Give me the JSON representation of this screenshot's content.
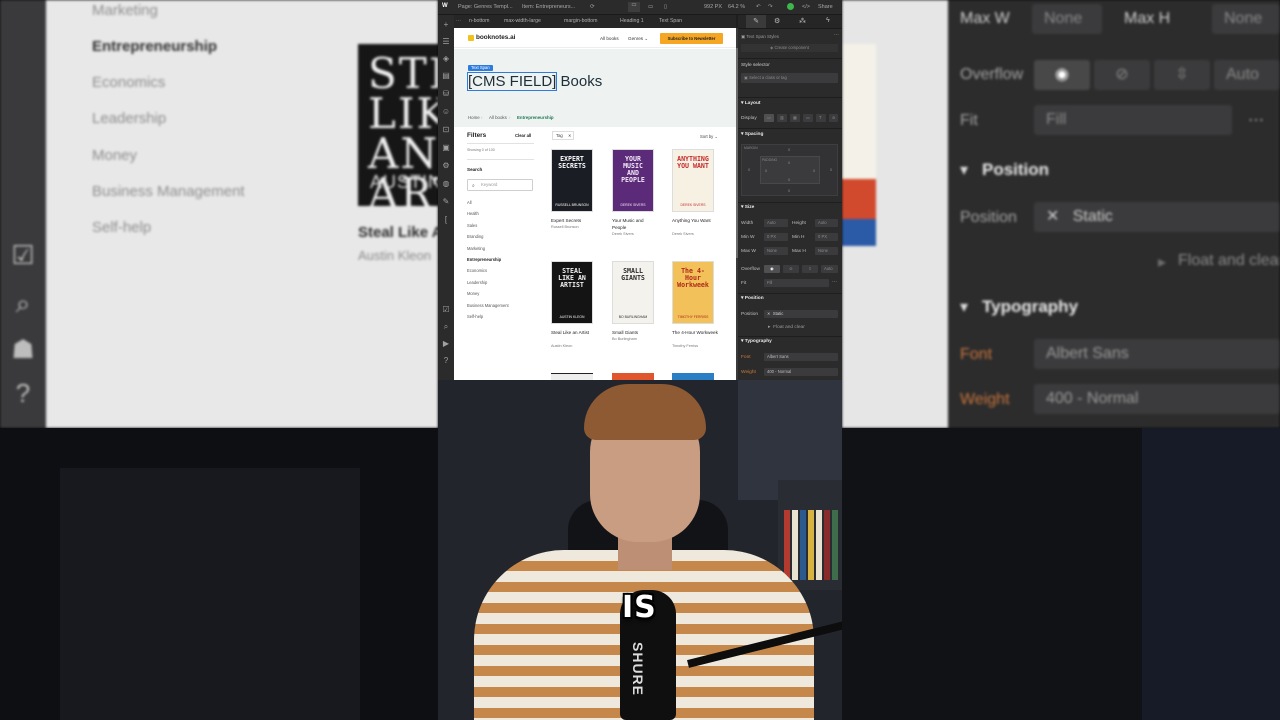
{
  "background_left": {
    "categories": [
      {
        "label": "Marketing",
        "active": false
      },
      {
        "label": "Entrepreneurship",
        "active": true
      },
      {
        "label": "Economics",
        "active": false
      },
      {
        "label": "Leadership",
        "active": false
      },
      {
        "label": "Money",
        "active": false
      },
      {
        "label": "Business Management",
        "active": false
      },
      {
        "label": "Self-help",
        "active": false
      }
    ],
    "book_cover_text": "STEAL LIKE AN ARTIST",
    "book_cover_author": "AUSTIN",
    "book_title": "Steal Like A",
    "book_author": "Austin Kleon"
  },
  "background_right": {
    "max_w_label": "Max W",
    "max_w_value": "None",
    "max_h_label": "Max H",
    "max_h_value": "None",
    "overflow_label": "Overflow",
    "overflow_auto": "Auto",
    "fit_label": "Fit",
    "fit_value": "Fill",
    "position_header": "Position",
    "position_label": "Position",
    "position_value": "Static",
    "float_clear": "Float and clear",
    "typography_header": "Typography",
    "font_label": "Font",
    "font_value": "Albert Sans",
    "weight_label": "Weight",
    "weight_value": "400 - Normal"
  },
  "webflow": {
    "topbar": {
      "page": "Page: Genres Templ...",
      "item": "Item: Entrepreneurs...",
      "width": "992 PX",
      "zoom": "64.2 %",
      "share": "Share"
    },
    "breadcrumbs": [
      "n-bottom",
      "max-width-large",
      "margin-bottom",
      "Heading 1",
      "Text Span"
    ],
    "site": {
      "logo": "booknotes.ai",
      "nav_all_books": "All books",
      "nav_genres": "Genres",
      "nav_cta": "Subscribe to Newsletter",
      "badge": "Text Span",
      "hero_cms": "[CMS FIELD]",
      "hero_rest": " Books",
      "crumb_home": "Home",
      "crumb_all": "All books",
      "crumb_current": "Entrepreneurship",
      "filters": "Filters",
      "clear_all": "Clear all",
      "showing": "Showing 0 of 100",
      "tag": "Tag",
      "sort_by": "Sort by",
      "search_label": "Search",
      "keyword_placeholder": "Keyword",
      "filter_categories": [
        {
          "label": "All",
          "active": false
        },
        {
          "label": "Health",
          "active": false
        },
        {
          "label": "Sales",
          "active": false
        },
        {
          "label": "Branding",
          "active": false
        },
        {
          "label": "Marketing",
          "active": false
        },
        {
          "label": "Entrepreneurship",
          "active": true
        },
        {
          "label": "Economics",
          "active": false
        },
        {
          "label": "Leadership",
          "active": false
        },
        {
          "label": "Money",
          "active": false
        },
        {
          "label": "Business Management",
          "active": false
        },
        {
          "label": "Self-help",
          "active": false
        }
      ],
      "books": [
        {
          "title": "Expert Secrets",
          "author": "Russell Brunson",
          "cover": "EXPERT SECRETS",
          "cover_author": "RUSSELL BRUNSON",
          "bg": "#1b1d24",
          "fg": "#ffffff"
        },
        {
          "title": "Your Music and People",
          "author": "Derek Sivers",
          "cover": "YOUR MUSIC AND PEOPLE",
          "cover_author": "DEREK SIVERS",
          "bg": "#5b2a78",
          "fg": "#f3e9f8"
        },
        {
          "title": "Anything You Want",
          "author": "Derek Sivers",
          "cover": "ANYTHING YOU WANT",
          "cover_author": "DEREK SIVERS",
          "bg": "#f7f1e4",
          "fg": "#c62b2b"
        },
        {
          "title": "Steal Like an Artist",
          "author": "Austin Kleon",
          "cover": "STEAL LIKE AN ARTIST",
          "cover_author": "AUSTIN KLEON",
          "bg": "#141414",
          "fg": "#f2f2f2"
        },
        {
          "title": "Small Giants",
          "author": "Bo Burlingham",
          "cover": "SMALL GIANTS",
          "cover_author": "BO BURLINGHAM",
          "bg": "#f4f2ec",
          "fg": "#2a2a2a"
        },
        {
          "title": "The 4-Hour Workweek",
          "author": "Timothy Ferriss",
          "cover": "The 4-Hour Workweek",
          "cover_author": "TIMOTHY FERRISS",
          "bg": "#f2c15a",
          "fg": "#b02a1c"
        }
      ]
    },
    "panel": {
      "breadcrumb": "Text Span Styles",
      "create_component": "Create component",
      "style_selector": "Style selector",
      "select_placeholder": "Select a class or tag",
      "layout": "Layout",
      "display": "Display",
      "spacing": "Spacing",
      "margin": "MARGIN",
      "padding": "PADDING",
      "zero": "0",
      "size": "Size",
      "width": "Width",
      "height": "Height",
      "auto": "Auto",
      "min_w": "Min W",
      "min_h": "Min H",
      "max_w": "Max W",
      "max_h": "Max H",
      "none": "None",
      "px_zero": "0 PX",
      "overflow": "Overflow",
      "fit": "Fit",
      "fill": "Fill",
      "position_h": "Position",
      "position": "Position",
      "static": "Static",
      "float_clear": "Float and clear",
      "typography": "Typography",
      "font": "Font",
      "font_value": "Albert Sans",
      "weight": "Weight",
      "weight_value": "400 - Normal"
    }
  },
  "caption": "IS",
  "mic_brand": "SHURE"
}
